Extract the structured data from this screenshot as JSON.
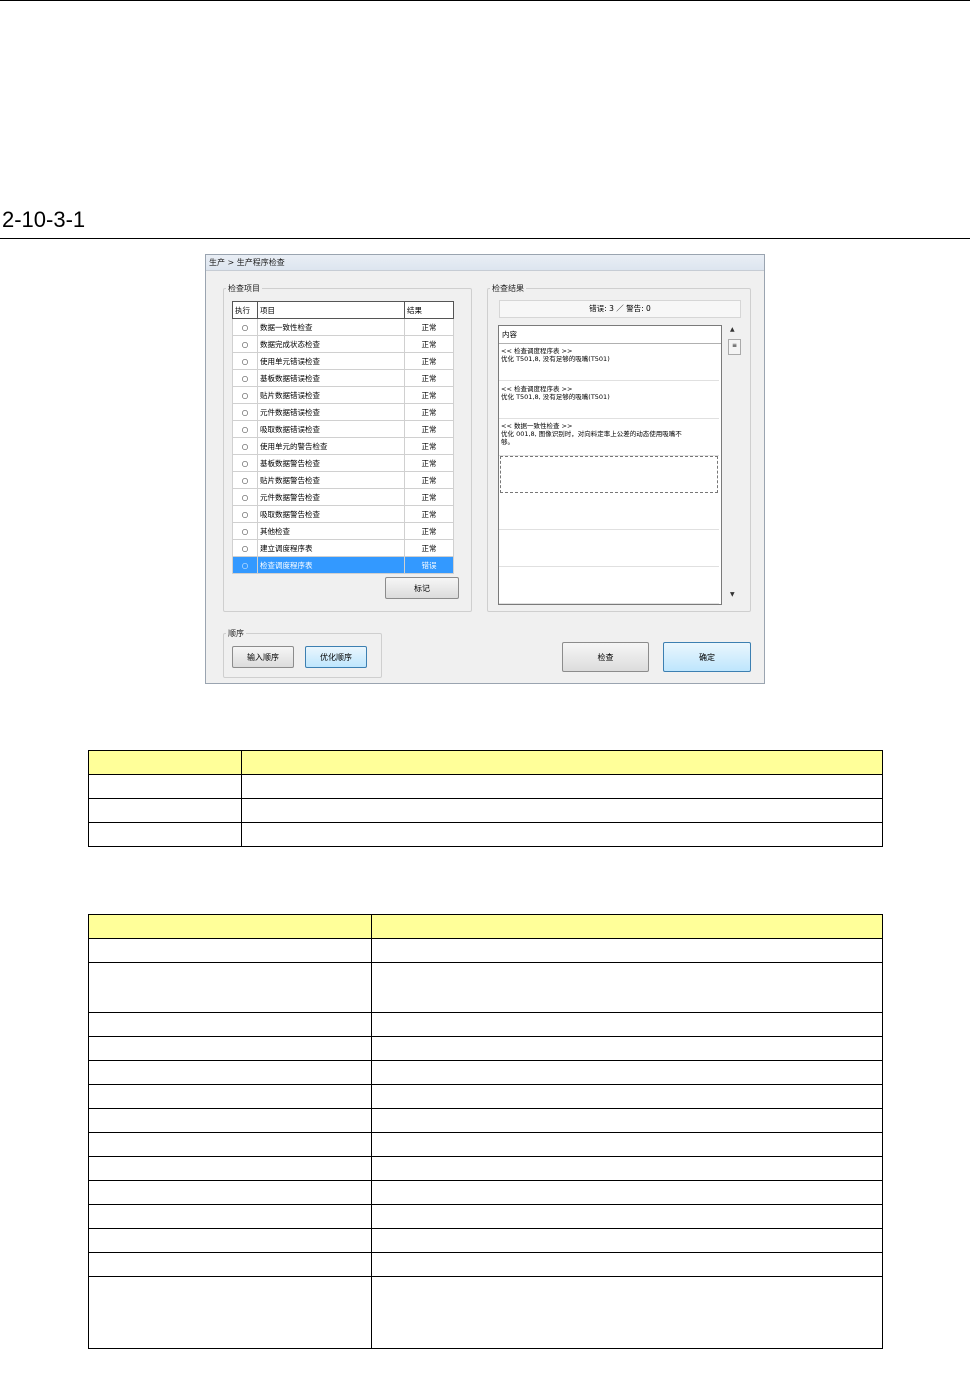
{
  "figure": {
    "caption": "2-10-3-1"
  },
  "dialog": {
    "title": "生产 > 生产程序检查",
    "check_items_group": "检查项目",
    "table_headers": {
      "execute": "执行",
      "item": "项目",
      "result": "结果"
    },
    "items": [
      {
        "run": "○",
        "name": "数据一致性检查",
        "result": "正常"
      },
      {
        "run": "○",
        "name": "数据完成状态检查",
        "result": "正常"
      },
      {
        "run": "○",
        "name": "使用单元错误检查",
        "result": "正常"
      },
      {
        "run": "○",
        "name": "基板数据错误检查",
        "result": "正常"
      },
      {
        "run": "○",
        "name": "贴片数据错误检查",
        "result": "正常"
      },
      {
        "run": "○",
        "name": "元件数据错误检查",
        "result": "正常"
      },
      {
        "run": "○",
        "name": "吸取数据错误检查",
        "result": "正常"
      },
      {
        "run": "○",
        "name": "使用单元的警告检查",
        "result": "正常"
      },
      {
        "run": "○",
        "name": "基板数据警告检查",
        "result": "正常"
      },
      {
        "run": "○",
        "name": "贴片数据警告检查",
        "result": "正常"
      },
      {
        "run": "○",
        "name": "元件数据警告检查",
        "result": "正常"
      },
      {
        "run": "○",
        "name": "吸取数据警告检查",
        "result": "正常"
      },
      {
        "run": "○",
        "name": "其他检查",
        "result": "正常"
      },
      {
        "run": "○",
        "name": "建立调度程序表",
        "result": "正常"
      },
      {
        "run": "○",
        "name": "检查调度程序表",
        "result": "错误"
      }
    ],
    "mark_button": "标记",
    "results_group": "检查结果",
    "summary": "错误: 3 ／ 警告: 0",
    "results_header": "内容",
    "messages": [
      {
        "line1": "<< 检查调度程序表 >>",
        "line2": "优化 T501,8, 没有足够的吸嘴(T501)",
        "line3": ""
      },
      {
        "line1": "<< 检查调度程序表 >>",
        "line2": "优化 T501,8, 没有足够的吸嘴(T501)",
        "line3": ""
      },
      {
        "line1": "<< 数据一致性检查 >>",
        "line2": "优化 001,8, 图像识别时，对向料定率上公差的动态使用吸嘴不",
        "line3": "够。"
      }
    ],
    "sequence_group": "顺序",
    "input_order_button": "输入顺序",
    "optimize_order_button": "优化顺序",
    "check_button": "检查",
    "ok_button": "确定"
  }
}
